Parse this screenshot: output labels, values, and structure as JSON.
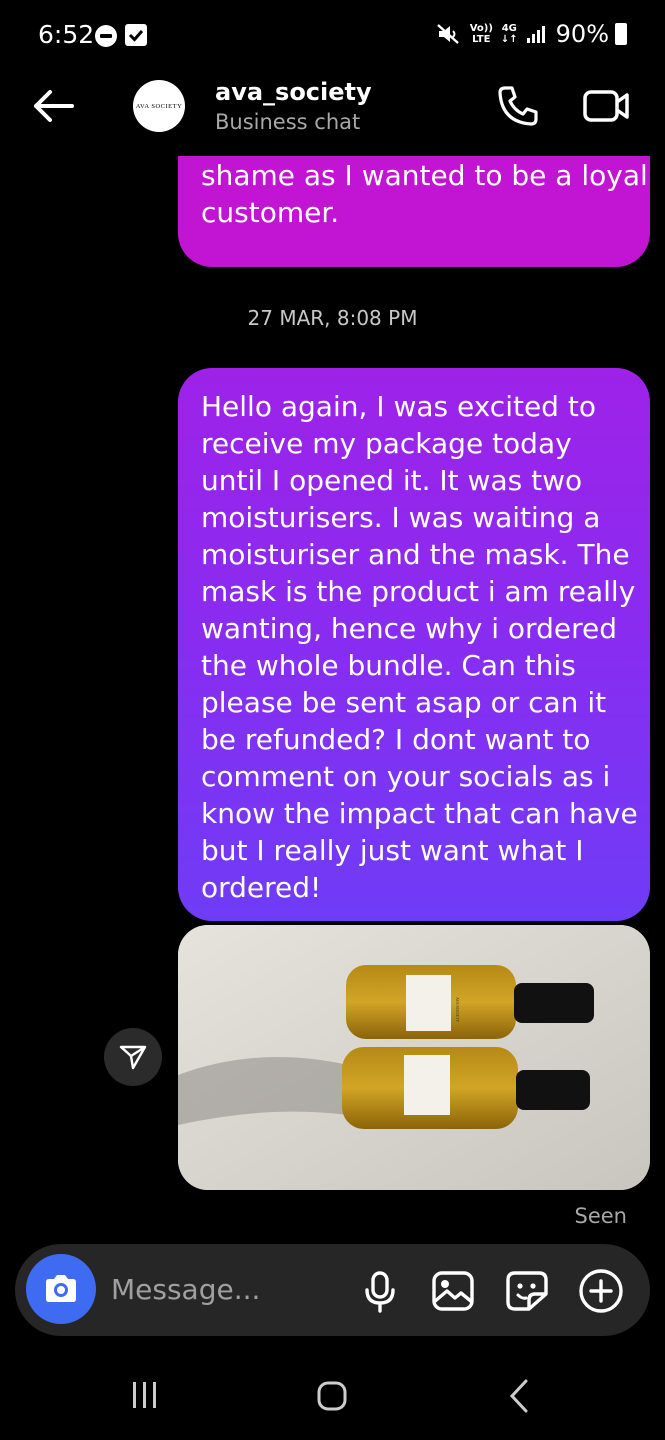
{
  "status_bar": {
    "time": "6:52",
    "network": "4G",
    "volte_top": "Vo))",
    "volte_bottom": "LTE",
    "battery": "90%"
  },
  "header": {
    "avatar_text": "AVA SOCIETY",
    "name": "ava_society",
    "subtitle": "Business chat",
    "icons": [
      "back-arrow-icon",
      "phone-icon",
      "video-camera-icon"
    ]
  },
  "messages": {
    "previous_bubble": "I have run out of options. It's a\nshame as I wanted to be a loyal\ncustomer.",
    "timestamp": "27 MAR, 8:08 PM",
    "main_bubble": "Hello again, I was excited to\nreceive my package today\nuntil I opened it. It was two\nmoisturisers. I was waiting a\nmoisturiser and the mask. The\nmask is the product i am really\nwanting, hence why i ordered\nthe whole bundle. Can this\nplease be sent asap or can it\nbe refunded? I dont want to\ncomment on your socials as i\nknow the impact that can have\nbut I really just want what I\nordered!",
    "photo_label": "AVA SOCIETY",
    "seen": "Seen"
  },
  "composer": {
    "placeholder": "Message..."
  },
  "colors": {
    "top_bubble": "#c214d3",
    "main_bubble_top": "#9e22e8",
    "main_bubble_bottom": "#6f3cf6",
    "camera_button": "#3f6bf2",
    "composer_bg": "#262626"
  }
}
